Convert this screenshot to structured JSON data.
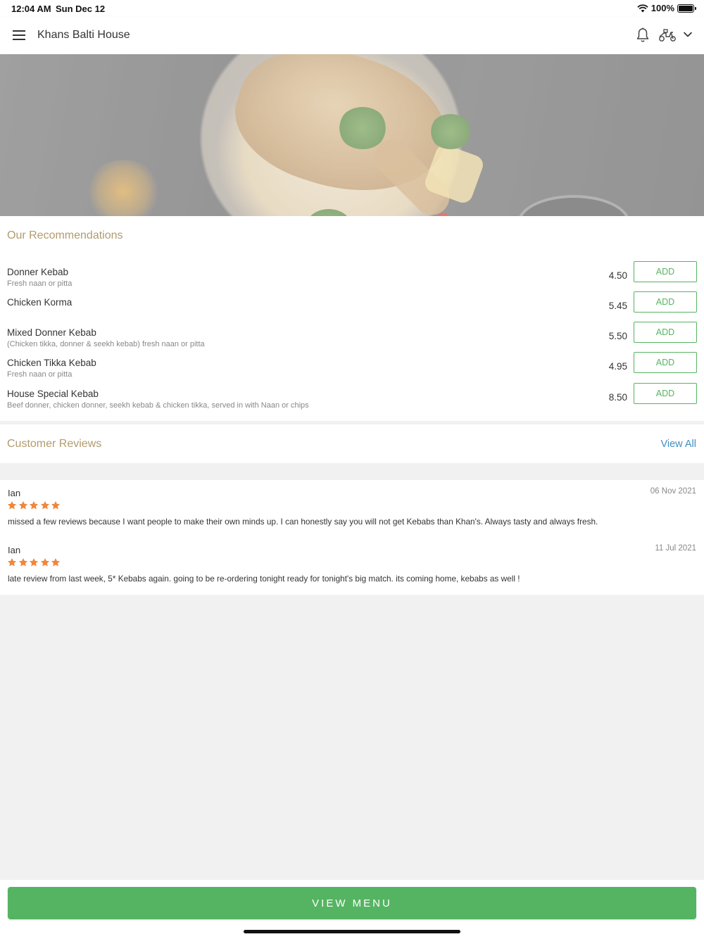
{
  "status_bar": {
    "time": "12:04 AM",
    "date": "Sun Dec 12",
    "battery_percent": "100%",
    "battery_level": 1.0
  },
  "app_bar": {
    "title": "Khans Balti House",
    "icons": [
      "menu-icon",
      "bell-icon",
      "scooter-icon",
      "chevron-down-icon"
    ]
  },
  "recommendations": {
    "title": "Our Recommendations",
    "add_label": "ADD",
    "items": [
      {
        "name": "Donner Kebab",
        "desc": "Fresh naan or pitta",
        "price": "4.50"
      },
      {
        "name": "Chicken Korma",
        "desc": "",
        "price": "5.45"
      },
      {
        "name": "Mixed Donner Kebab",
        "desc": "(Chicken tikka, donner & seekh kebab) fresh naan or pitta",
        "price": "5.50"
      },
      {
        "name": "Chicken Tikka Kebab",
        "desc": "Fresh naan or pitta",
        "price": "4.95"
      },
      {
        "name": "House Special Kebab",
        "desc": "Beef donner, chicken donner, seekh kebab & chicken tikka, served in with Naan or chips",
        "price": "8.50"
      }
    ]
  },
  "reviews": {
    "title": "Customer Reviews",
    "view_all": "View All",
    "items": [
      {
        "author": "Ian",
        "date": "06 Nov 2021",
        "rating": 5,
        "text": "missed a few reviews because I want people to make their own minds up.  I can honestly say you will not get Kebabs than Khan's.  Always tasty and always fresh."
      },
      {
        "author": "Ian",
        "date": "11 Jul 2021",
        "rating": 5,
        "text": "late review from last week, 5* Kebabs again.  going to be re-ordering tonight ready for tonight's big match.  its coming home, kebabs as well !"
      }
    ]
  },
  "footer": {
    "view_menu": "VIEW MENU"
  },
  "colors": {
    "accent_green": "#55b461",
    "section_gold": "#b29b6f",
    "link_blue": "#3e8fc4",
    "star_orange": "#f0873a"
  }
}
